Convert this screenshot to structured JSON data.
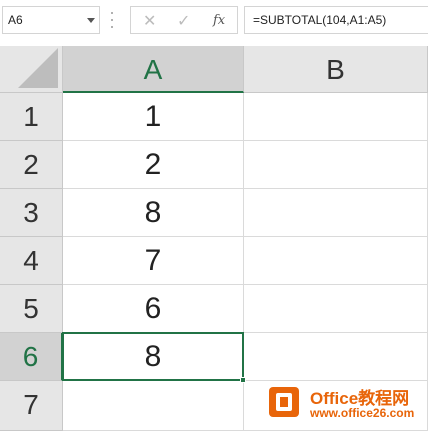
{
  "formula_bar": {
    "name_box": "A6",
    "cancel_icon": "close-icon",
    "enter_icon": "check-icon",
    "fx_label": "fx",
    "formula": "=SUBTOTAL(104,A1:A5)"
  },
  "columns": [
    {
      "label": "A",
      "selected": true
    },
    {
      "label": "B",
      "selected": false
    }
  ],
  "rows": [
    {
      "label": "1",
      "a": "1",
      "b": "",
      "selected": false
    },
    {
      "label": "2",
      "a": "2",
      "b": "",
      "selected": false
    },
    {
      "label": "3",
      "a": "8",
      "b": "",
      "selected": false
    },
    {
      "label": "4",
      "a": "7",
      "b": "",
      "selected": false
    },
    {
      "label": "5",
      "a": "6",
      "b": "",
      "selected": false
    },
    {
      "label": "6",
      "a": "8",
      "b": "",
      "selected": true
    },
    {
      "label": "7",
      "a": "",
      "b": "",
      "selected": false
    }
  ],
  "active_cell": "A6",
  "colors": {
    "accent": "#217346",
    "header_bg": "#e6e6e6",
    "header_selected_bg": "#d2d2d2",
    "watermark": "#e8650a"
  },
  "watermark": {
    "title": "Office教程网",
    "url": "www.office26.com"
  }
}
